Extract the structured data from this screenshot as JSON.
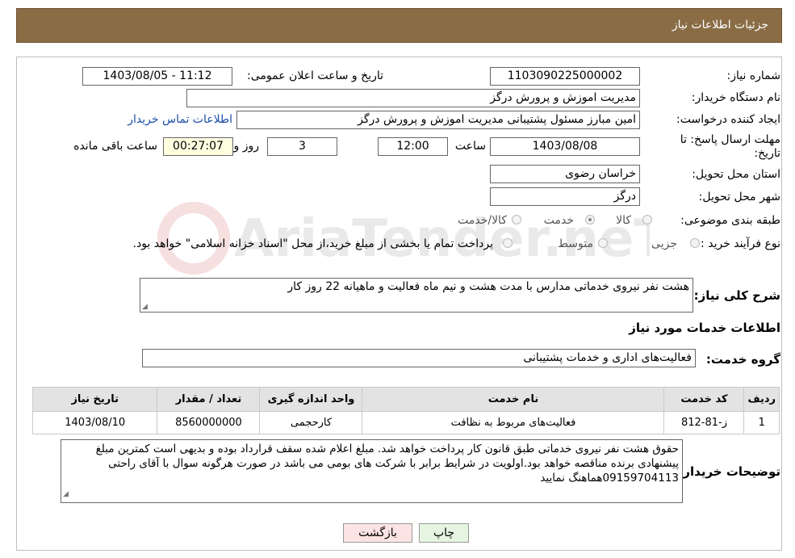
{
  "header": {
    "title": "جزئیات اطلاعات نیاز"
  },
  "form": {
    "need_number_label": "شماره نیاز:",
    "need_number": "1103090225000002",
    "announce_label": "تاریخ و ساعت اعلان عمومی:",
    "announce_value": "1403/08/05 - 11:12",
    "buyer_label": "نام دستگاه خریدار:",
    "buyer_value": "مدیریت اموزش و پرورش درگز",
    "creator_label": "ایجاد کننده درخواست:",
    "creator_value": "امین مبارز مسئول پشتیبانی مدیریت اموزش و پرورش درگز",
    "contact_link": "اطلاعات تماس خریدار",
    "deadline_label_1": "مهلت ارسال پاسخ: تا",
    "deadline_label_2": "تاریخ:",
    "deadline_date": "1403/08/08",
    "time_label": "ساعت",
    "deadline_time": "12:00",
    "days_value": "3",
    "days_label": "روز و",
    "remaining_value": "00:27:07",
    "remaining_label": "ساعت باقی مانده",
    "province_label": "استان محل تحویل:",
    "province_value": "خراسان رضوی",
    "city_label": "شهر محل تحویل:",
    "city_value": "درگز",
    "category_label": "طبقه بندی موضوعی:",
    "category_options": [
      "کالا",
      "خدمت",
      "کالا/خدمت"
    ],
    "category_selected": "خدمت",
    "process_label": "نوع فرآیند خرید :",
    "process_options": [
      "جزیی",
      "متوسط"
    ],
    "process_note": "پرداخت تمام یا بخشی از مبلغ خرید،از محل \"اسناد خزانه اسلامی\" خواهد بود."
  },
  "description": {
    "label": "شرح کلی نیاز:",
    "value": "هشت نفر نیروی خدماتی مدارس با مدت هشت و نیم ماه فعالیت و ماهیانه 22 روز کار"
  },
  "services": {
    "section_title": "اطلاعات خدمات مورد نیاز",
    "group_label": "گروه خدمت:",
    "group_value": "فعالیت‌های اداری و خدمات پشتیبانی",
    "columns": [
      "ردیف",
      "کد خدمت",
      "نام خدمت",
      "واحد اندازه گیری",
      "تعداد / مقدار",
      "تاریخ نیاز"
    ],
    "rows": [
      [
        "1",
        "ز-81-812",
        "فعالیت‌های مربوط به نظافت",
        "کارحجمی",
        "8560000000",
        "1403/08/10"
      ]
    ]
  },
  "buyer_notes": {
    "label": "توضیحات خریدار:",
    "value": "حقوق هشت نفر نیروی خدماتی طبق قانون کار پرداخت خواهد شد. مبلغ اعلام شده سقف قرارداد بوده و بدیهی است کمترین مبلغ پیشنهادی برنده مناقصه خواهد بود.اولویت در شرایط برابر با شرکت های بومی می باشد در صورت هرگونه سوال با آقای راحتی 09159704113هماهنگ نمایید"
  },
  "buttons": {
    "print": "چاپ",
    "back": "بازگشت"
  },
  "colors": {
    "header_bg": "#8a6d45",
    "back_button_bg": "#fde4e4",
    "print_button_bg": "#e6f5e1",
    "link": "#1a4ea8"
  },
  "watermark": "AriaTender.neT"
}
